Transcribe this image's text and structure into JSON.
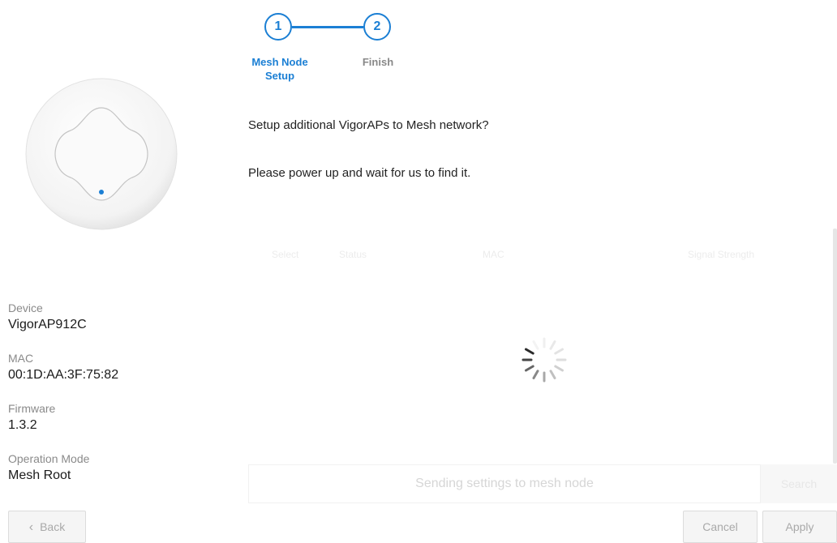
{
  "stepper": {
    "steps": [
      {
        "number": "1",
        "label_line1": "Mesh Node",
        "label_line2": "Setup",
        "state": "active"
      },
      {
        "number": "2",
        "label_line1": "Finish",
        "label_line2": "",
        "state": "inactive"
      }
    ],
    "active_color": "#1b7fd4",
    "inactive_color": "#888888"
  },
  "message": {
    "question": "Setup additional VigorAPs to Mesh network?",
    "instruction": "Please power up and wait for us to find it."
  },
  "table_header_faded": [
    "Select",
    "Status",
    "MAC",
    "Signal Strength"
  ],
  "device_info": {
    "device_label": "Device",
    "device_value": "VigorAP912C",
    "mac_label": "MAC",
    "mac_value": "00:1D:AA:3F:75:82",
    "firmware_label": "Firmware",
    "firmware_value": "1.3.2",
    "mode_label": "Operation Mode",
    "mode_value": "Mesh Root"
  },
  "status": {
    "text": "Sending settings to mesh node",
    "search_label": "Search"
  },
  "buttons": {
    "back": "Back",
    "back_icon": "chevron-left-icon",
    "cancel": "Cancel",
    "apply": "Apply"
  }
}
